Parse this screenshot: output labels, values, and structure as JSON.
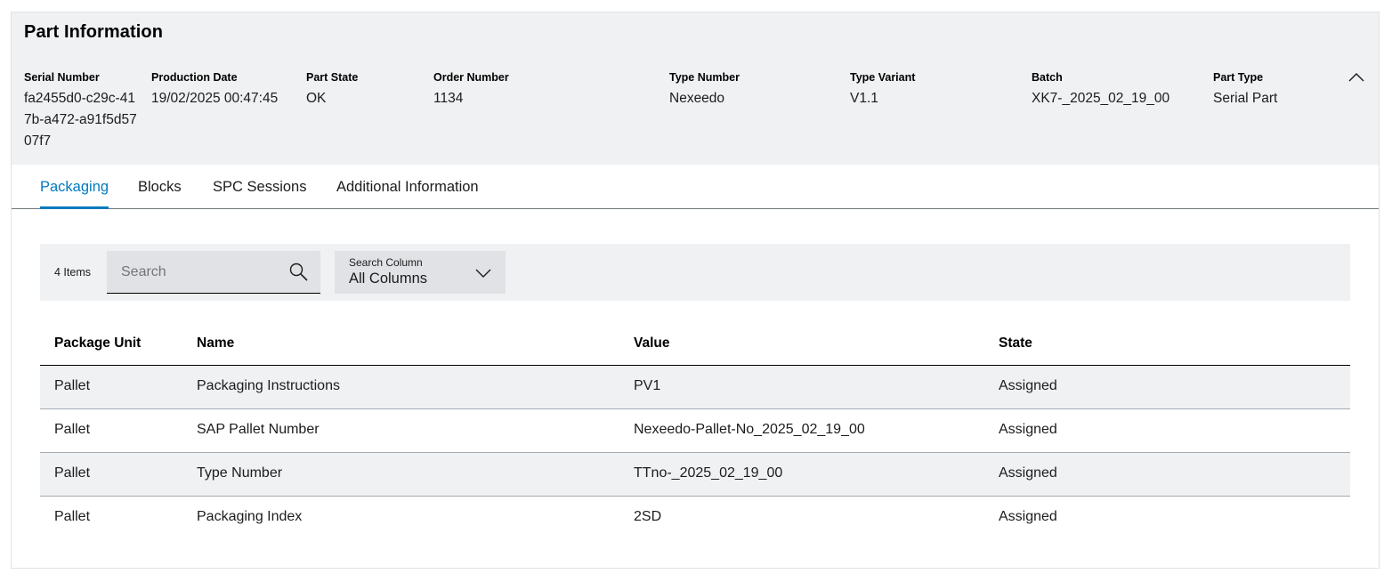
{
  "part_info": {
    "title": "Part Information",
    "fields": [
      {
        "label": "Serial Number",
        "value": "fa2455d0-c29c-417b-a472-a91f5d5707f7"
      },
      {
        "label": "Production Date",
        "value": "19/02/2025 00:47:45"
      },
      {
        "label": "Part State",
        "value": "OK"
      },
      {
        "label": "Order Number",
        "value": "1134"
      },
      {
        "label": "Type Number",
        "value": "Nexeedo"
      },
      {
        "label": "Type Variant",
        "value": "V1.1"
      },
      {
        "label": "Batch",
        "value": "XK7-_2025_02_19_00"
      },
      {
        "label": "Part Type",
        "value": "Serial Part"
      }
    ]
  },
  "tabs": [
    {
      "label": "Packaging",
      "active": true
    },
    {
      "label": "Blocks",
      "active": false
    },
    {
      "label": "SPC Sessions",
      "active": false
    },
    {
      "label": "Additional Information",
      "active": false
    }
  ],
  "toolbar": {
    "item_count": "4 Items",
    "search_placeholder": "Search",
    "search_column_label": "Search Column",
    "search_column_value": "All Columns"
  },
  "table": {
    "columns": [
      "Package Unit",
      "Name",
      "Value",
      "State"
    ],
    "rows": [
      [
        "Pallet",
        "Packaging Instructions",
        "PV1",
        "Assigned"
      ],
      [
        "Pallet",
        "SAP Pallet Number",
        "Nexeedo-Pallet-No_2025_02_19_00",
        "Assigned"
      ],
      [
        "Pallet",
        "Type Number",
        "TTno-_2025_02_19_00",
        "Assigned"
      ],
      [
        "Pallet",
        "Packaging Index",
        "2SD",
        "Assigned"
      ]
    ]
  },
  "colors": {
    "accent": "#007bc0",
    "panel_bg": "#eff1f2",
    "input_bg": "#e0e2e5"
  },
  "icons": {
    "collapse": "chevron-up-icon",
    "search": "search-icon",
    "dropdown": "chevron-down-icon"
  }
}
